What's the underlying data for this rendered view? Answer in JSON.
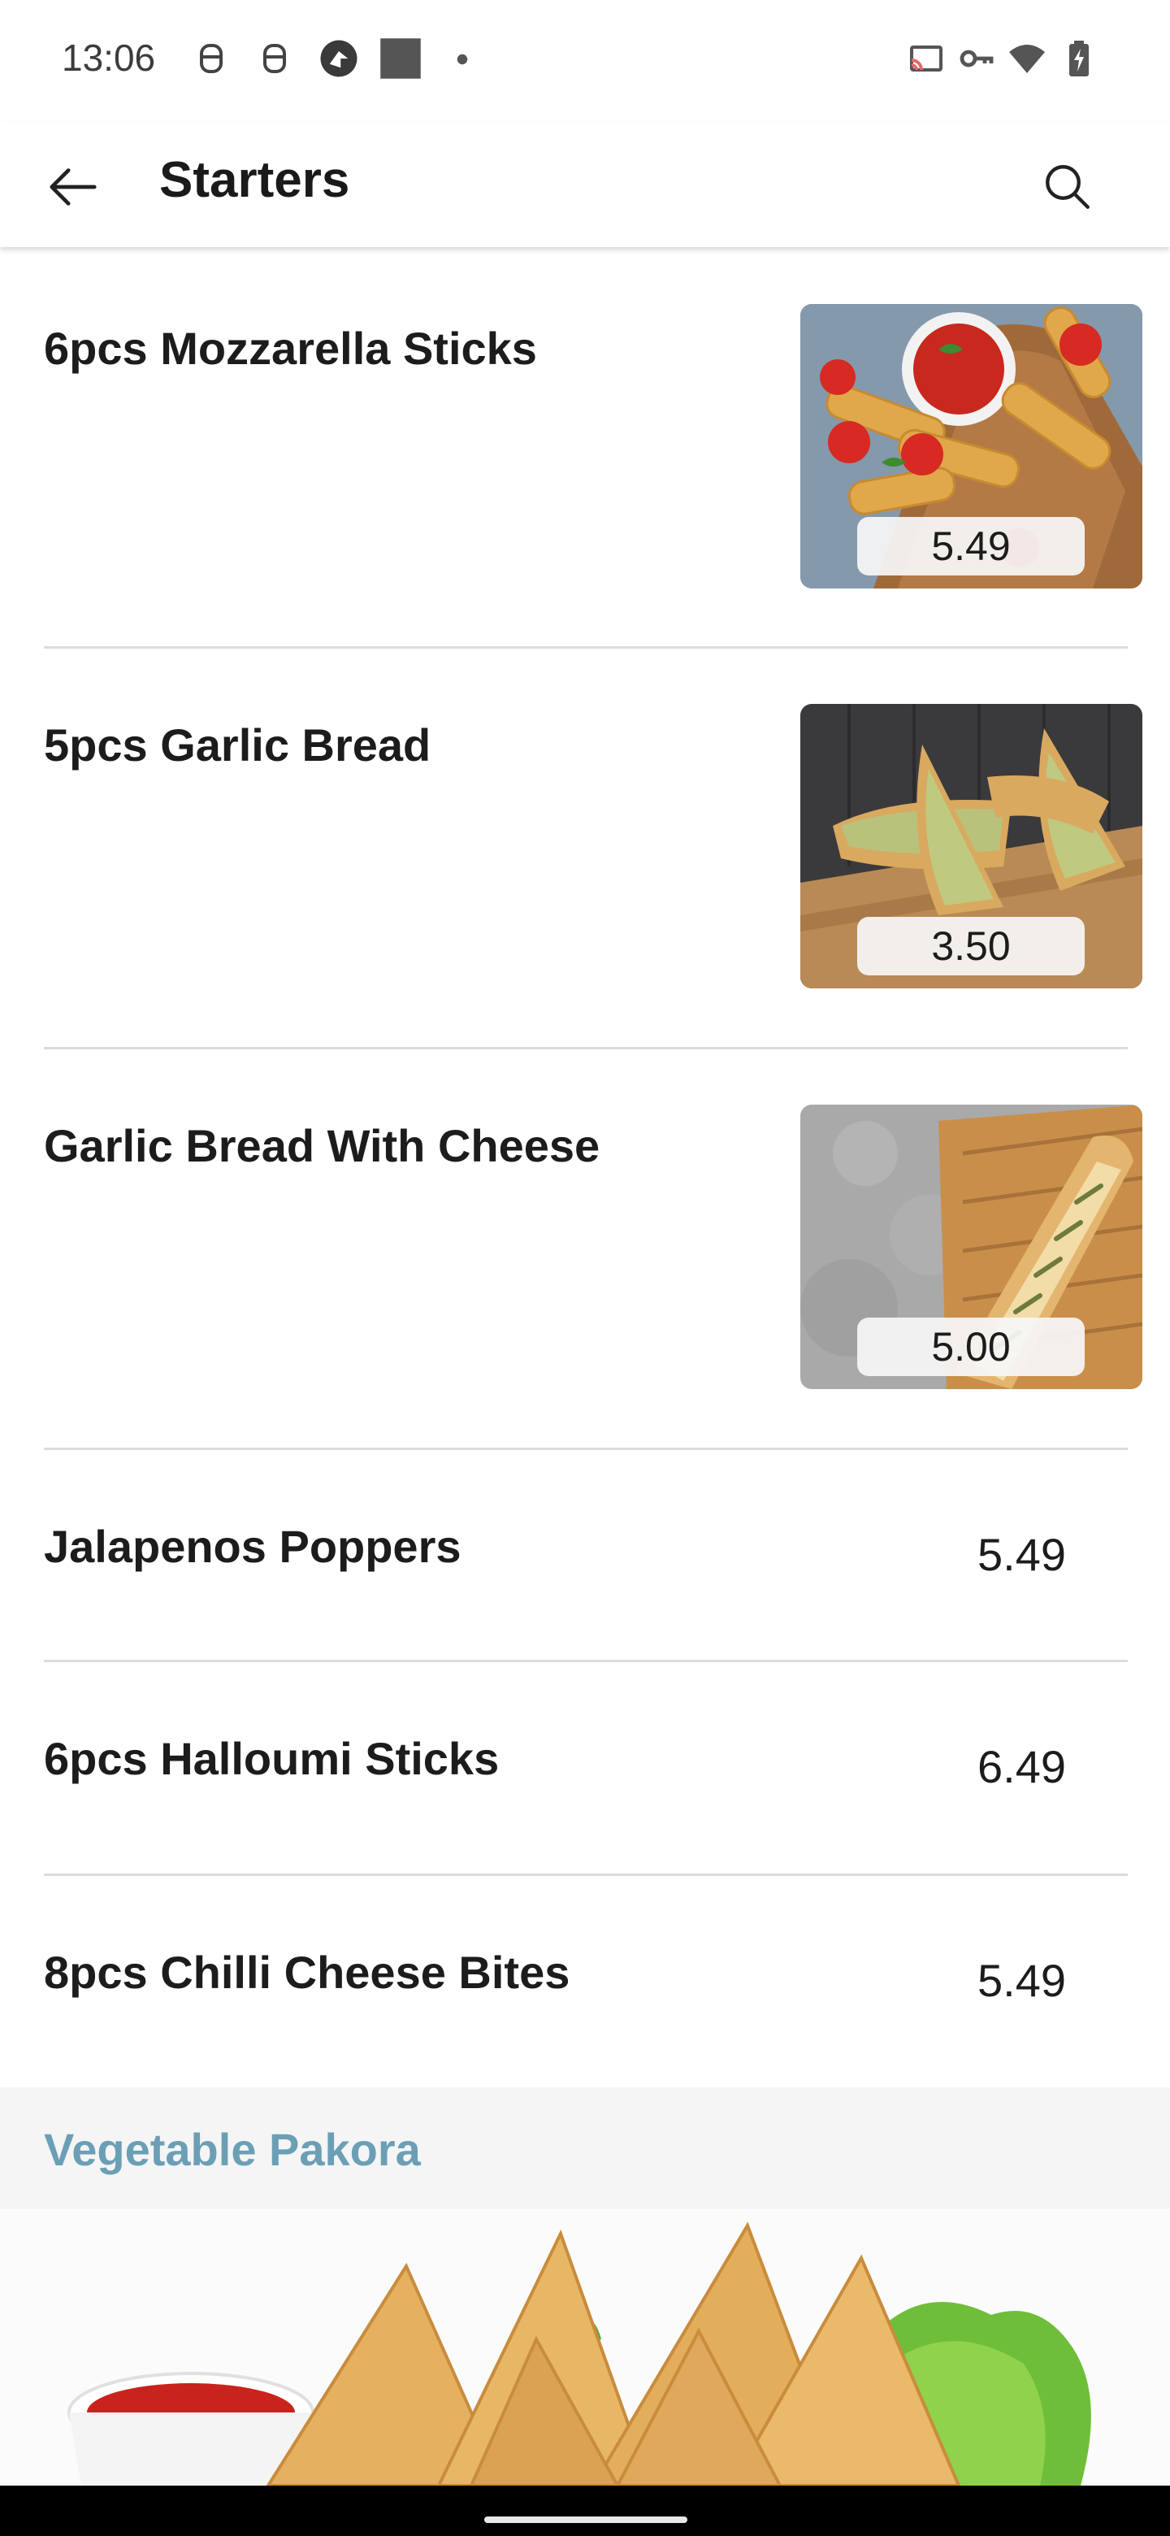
{
  "status_bar": {
    "time": "13:06",
    "left_icons": [
      "notification-icon",
      "notification-icon",
      "app-icon",
      "square-icon",
      "dot-icon"
    ],
    "right_icons": [
      "cast-icon",
      "vpn-key-icon",
      "wifi-icon",
      "battery-icon"
    ]
  },
  "app_bar": {
    "title": "Starters",
    "back_icon": "arrow-left-icon",
    "search_icon": "search-icon"
  },
  "items": [
    {
      "name": "6pcs Mozzarella Sticks",
      "price": "5.49",
      "has_image": true,
      "image": "mozzarella-sticks-photo"
    },
    {
      "name": "5pcs Garlic Bread",
      "price": "3.50",
      "has_image": true,
      "image": "garlic-bread-photo"
    },
    {
      "name": "Garlic Bread With Cheese",
      "price": "5.00",
      "has_image": true,
      "image": "garlic-bread-cheese-photo"
    },
    {
      "name": "Jalapenos Poppers",
      "price": "5.49",
      "has_image": false
    },
    {
      "name": "6pcs Halloumi Sticks",
      "price": "6.49",
      "has_image": false
    },
    {
      "name": "8pcs Chilli Cheese Bites",
      "price": "5.49",
      "has_image": false
    }
  ],
  "section": {
    "title": "Vegetable Pakora",
    "title_color": "#6b9fb5",
    "banner_image": "samosa-banner-photo"
  },
  "colors": {
    "divider": "#dcdcdc",
    "section_bg": "#f5f5f5",
    "text": "#1c1c1c"
  }
}
